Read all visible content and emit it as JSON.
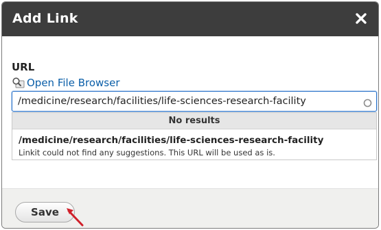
{
  "dialog": {
    "title": "Add Link",
    "close_icon": "close-icon"
  },
  "form": {
    "url_label": "URL",
    "file_browser_link": "Open File Browser",
    "file_browser_icon": "file-browser-icon",
    "url_value": "/medicine/research/facilities/life-sciences-research-facility"
  },
  "suggestions": {
    "header": "No results",
    "items": [
      {
        "path": "/medicine/research/facilities/life-sciences-research-facility",
        "description": "Linkit could not find any suggestions. This URL will be used as is."
      }
    ]
  },
  "footer": {
    "save_label": "Save"
  },
  "colors": {
    "titlebar": "#3d3d3d",
    "link": "#0a5ea8",
    "input_border": "#2a72c9",
    "annotation_arrow": "#d0202a"
  }
}
